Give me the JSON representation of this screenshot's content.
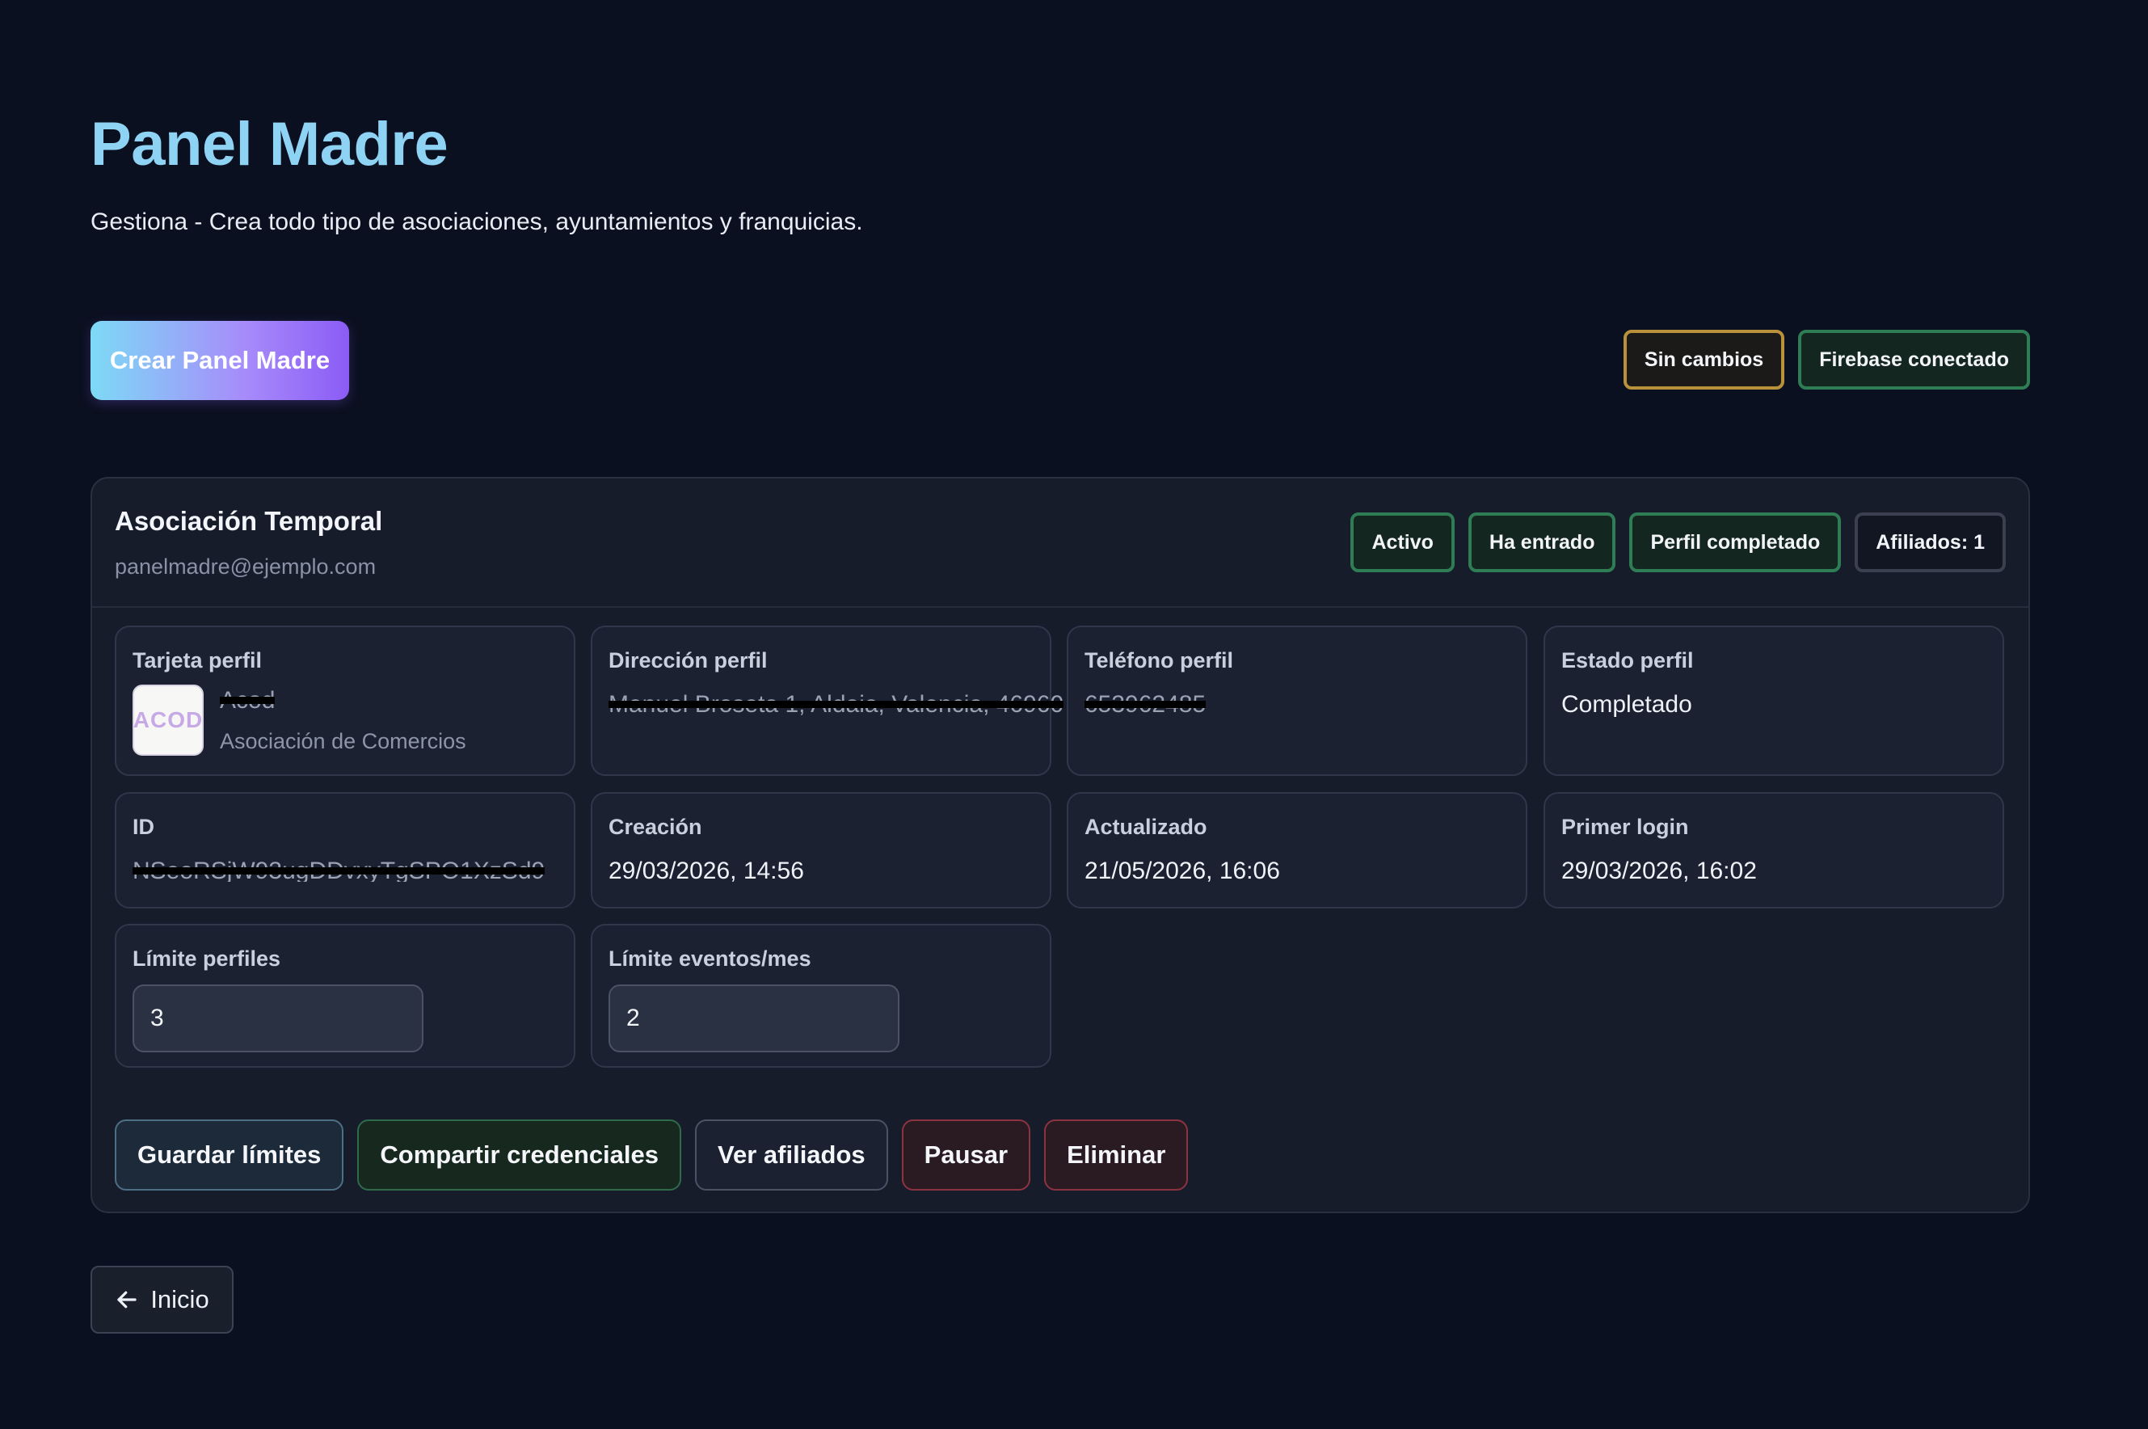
{
  "header": {
    "title": "Panel Madre",
    "subtitle": "Gestiona - Crea todo tipo de asociaciones, ayuntamientos y franquicias."
  },
  "toolbar": {
    "create_label": "Crear Panel Madre",
    "status_badges": [
      "Sin cambios",
      "Firebase conectado"
    ]
  },
  "card": {
    "name": "Asociación Temporal",
    "email": "panelmadre@ejemplo.com",
    "badges": [
      "Activo",
      "Ha entrado",
      "Perfil completado",
      "Afiliados: 1"
    ],
    "fields": {
      "tarjeta": {
        "label": "Tarjeta perfil",
        "name": "Acod",
        "category": "Asociación de Comercios",
        "logo_text": "ACOD"
      },
      "direccion": {
        "label": "Dirección perfil",
        "value": "Manuel Broseta 1, Aldaia, Valencia, 46960"
      },
      "telefono": {
        "label": "Teléfono perfil",
        "value": "653962485"
      },
      "estado": {
        "label": "Estado perfil",
        "value": "Completado"
      },
      "id": {
        "label": "ID",
        "value": "NSeoRSjW93ugDDvxyTgSPO1XzSd9"
      },
      "creacion": {
        "label": "Creación",
        "value": "29/03/2026, 14:56"
      },
      "actualizado": {
        "label": "Actualizado",
        "value": "21/05/2026, 16:06"
      },
      "primer_login": {
        "label": "Primer login",
        "value": "29/03/2026, 16:02"
      },
      "limite_perfiles": {
        "label": "Límite perfiles",
        "value": "3"
      },
      "limite_eventos": {
        "label": "Límite eventos/mes",
        "value": "2"
      }
    },
    "actions": {
      "save": "Guardar límites",
      "share": "Compartir credenciales",
      "view": "Ver afiliados",
      "pause": "Pausar",
      "delete": "Eliminar"
    }
  },
  "footer": {
    "home_label": "Inicio"
  }
}
